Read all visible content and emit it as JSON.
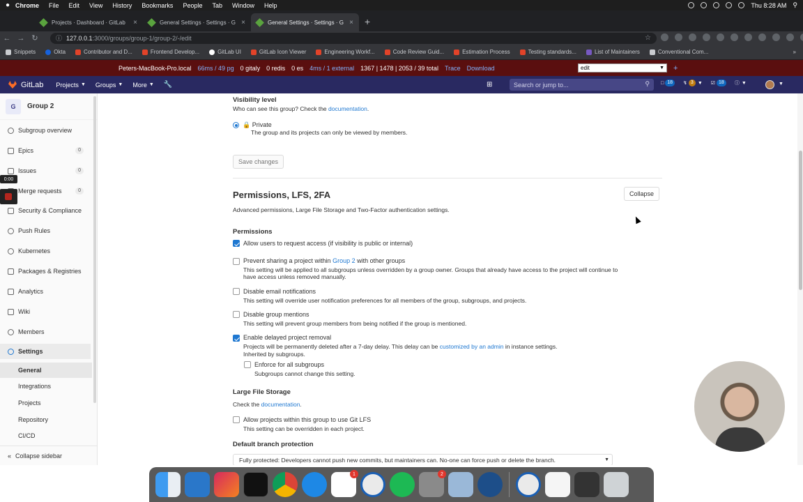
{
  "menubar": {
    "apple": "",
    "items": [
      "Chrome",
      "File",
      "Edit",
      "View",
      "History",
      "Bookmarks",
      "People",
      "Tab",
      "Window",
      "Help"
    ],
    "clock": "Thu 8:28 AM"
  },
  "tabs": [
    {
      "label": "Projects · Dashboard · GitLab"
    },
    {
      "label": "General Settings · Settings · G"
    },
    {
      "label": "General Settings · Settings · G"
    }
  ],
  "address": {
    "host": "127.0.0.1",
    "path": ":3000/groups/group-1/group-2/-/edit"
  },
  "bookmarks": [
    {
      "label": "Snippets",
      "icon": "grid-icon"
    },
    {
      "label": "Okta",
      "icon": "okta-icon"
    },
    {
      "label": "Contributor and D...",
      "icon": "gitlab-icon"
    },
    {
      "label": "Frontend Develop...",
      "icon": "gitlab-icon"
    },
    {
      "label": "GitLab UI",
      "icon": "github-icon"
    },
    {
      "label": "GitLab Icon Viewer",
      "icon": "gitlab-icon"
    },
    {
      "label": "Engineering Workf...",
      "icon": "gitlab-icon"
    },
    {
      "label": "Code Review Guid...",
      "icon": "gitlab-icon"
    },
    {
      "label": "Estimation Process",
      "icon": "gitlab-icon"
    },
    {
      "label": "Testing standards...",
      "icon": "gitlab-icon"
    },
    {
      "label": "List of Maintainers",
      "icon": "purple-icon"
    },
    {
      "label": "Conventional Com...",
      "icon": "doc-icon"
    }
  ],
  "perfbar": {
    "host": "Peters-MacBook-Pro.local",
    "pg": "66ms / 49 pg",
    "gitaly": "0 gitaly",
    "redis": "0 redis",
    "es": "0 es",
    "external": "4ms / 1 external",
    "totals": "1367 | 1478 | 2053 / 39 total",
    "trace": "Trace",
    "download": "Download",
    "env_value": "edit",
    "plus": "+"
  },
  "navbar": {
    "brand": "GitLab",
    "projects": "Projects",
    "groups": "Groups",
    "more": "More",
    "search_placeholder": "Search or jump to...",
    "issues_count": "18",
    "mr_count": "3",
    "todo_count": "18"
  },
  "sidebar": {
    "group_initial": "G",
    "group_name": "Group 2",
    "items": [
      {
        "label": "Subgroup overview",
        "count": ""
      },
      {
        "label": "Epics",
        "count": "0"
      },
      {
        "label": "Issues",
        "count": "0"
      },
      {
        "label": "Merge requests",
        "count": "0"
      },
      {
        "label": "Security & Compliance",
        "count": ""
      },
      {
        "label": "Push Rules",
        "count": ""
      },
      {
        "label": "Kubernetes",
        "count": ""
      },
      {
        "label": "Packages & Registries",
        "count": ""
      },
      {
        "label": "Analytics",
        "count": ""
      },
      {
        "label": "Wiki",
        "count": ""
      },
      {
        "label": "Members",
        "count": ""
      },
      {
        "label": "Settings",
        "count": ""
      }
    ],
    "sub_items": [
      "General",
      "Integrations",
      "Projects",
      "Repository",
      "CI/CD"
    ],
    "collapse": "Collapse sidebar",
    "timer": "0:00"
  },
  "visibility": {
    "title": "Visibility level",
    "help": "Who can see this group? Check the",
    "help_link": "documentation",
    "help_end": ".",
    "option_label": "Private",
    "option_desc": "The group and its projects can only be viewed by members.",
    "save": "Save changes"
  },
  "permissions": {
    "title": "Permissions, LFS, 2FA",
    "desc": "Advanced permissions, Large File Storage and Two-Factor authentication settings.",
    "collapse": "Collapse",
    "perm_heading": "Permissions",
    "request_access": "Allow users to request access (if visibility is public or internal)",
    "prevent_sharing_pre": "Prevent sharing a project within",
    "prevent_sharing_link": "Group 2",
    "prevent_sharing_post": "with other groups",
    "prevent_sharing_help": "This setting will be applied to all subgroups unless overridden by a group owner. Groups that already have access to the project will continue to have access unless removed manually.",
    "email_label": "Disable email notifications",
    "email_help": "This setting will override user notification preferences for all members of the group, subgroups, and projects.",
    "mentions_label": "Disable group mentions",
    "mentions_help": "This setting will prevent group members from being notified if the group is mentioned.",
    "delayed_label": "Enable delayed project removal",
    "delayed_help_pre": "Projects will be permanently deleted after a 7-day delay. This delay can be",
    "delayed_help_link": "customized by an admin",
    "delayed_help_post": "in instance settings.",
    "delayed_inherited": "Inherited by subgroups.",
    "enforce_label": "Enforce for all subgroups",
    "enforce_help": "Subgroups cannot change this setting.",
    "lfs_heading": "Large File Storage",
    "lfs_help": "Check the",
    "lfs_link": "documentation",
    "lfs_end": ".",
    "lfs_label": "Allow projects within this group to use Git LFS",
    "lfs_sub": "This setting can be overridden in each project.",
    "dbp_heading": "Default branch protection",
    "dbp_value": "Fully protected: Developers cannot push new commits, but maintainers can. No-one can force push or delete the branch."
  },
  "colors": {
    "navbar": "#292961",
    "perfbar": "#5a0f0f",
    "link": "#1f78d1",
    "accent_orange": "#fc6d26"
  },
  "dock": {
    "app_icons": [
      "finder-icon",
      "vscode-icon",
      "rubymine-icon",
      "terminal-icon",
      "chrome-icon",
      "safari-icon",
      "slack-icon",
      "1password-icon",
      "spotify-icon",
      "system-preferences-icon",
      "preview-icon",
      "pockity-icon",
      "1password-mini-icon",
      "document-icon",
      "screenshot-icon",
      "trash-icon"
    ],
    "slack_badge": "1",
    "prefs_badge": "2"
  }
}
